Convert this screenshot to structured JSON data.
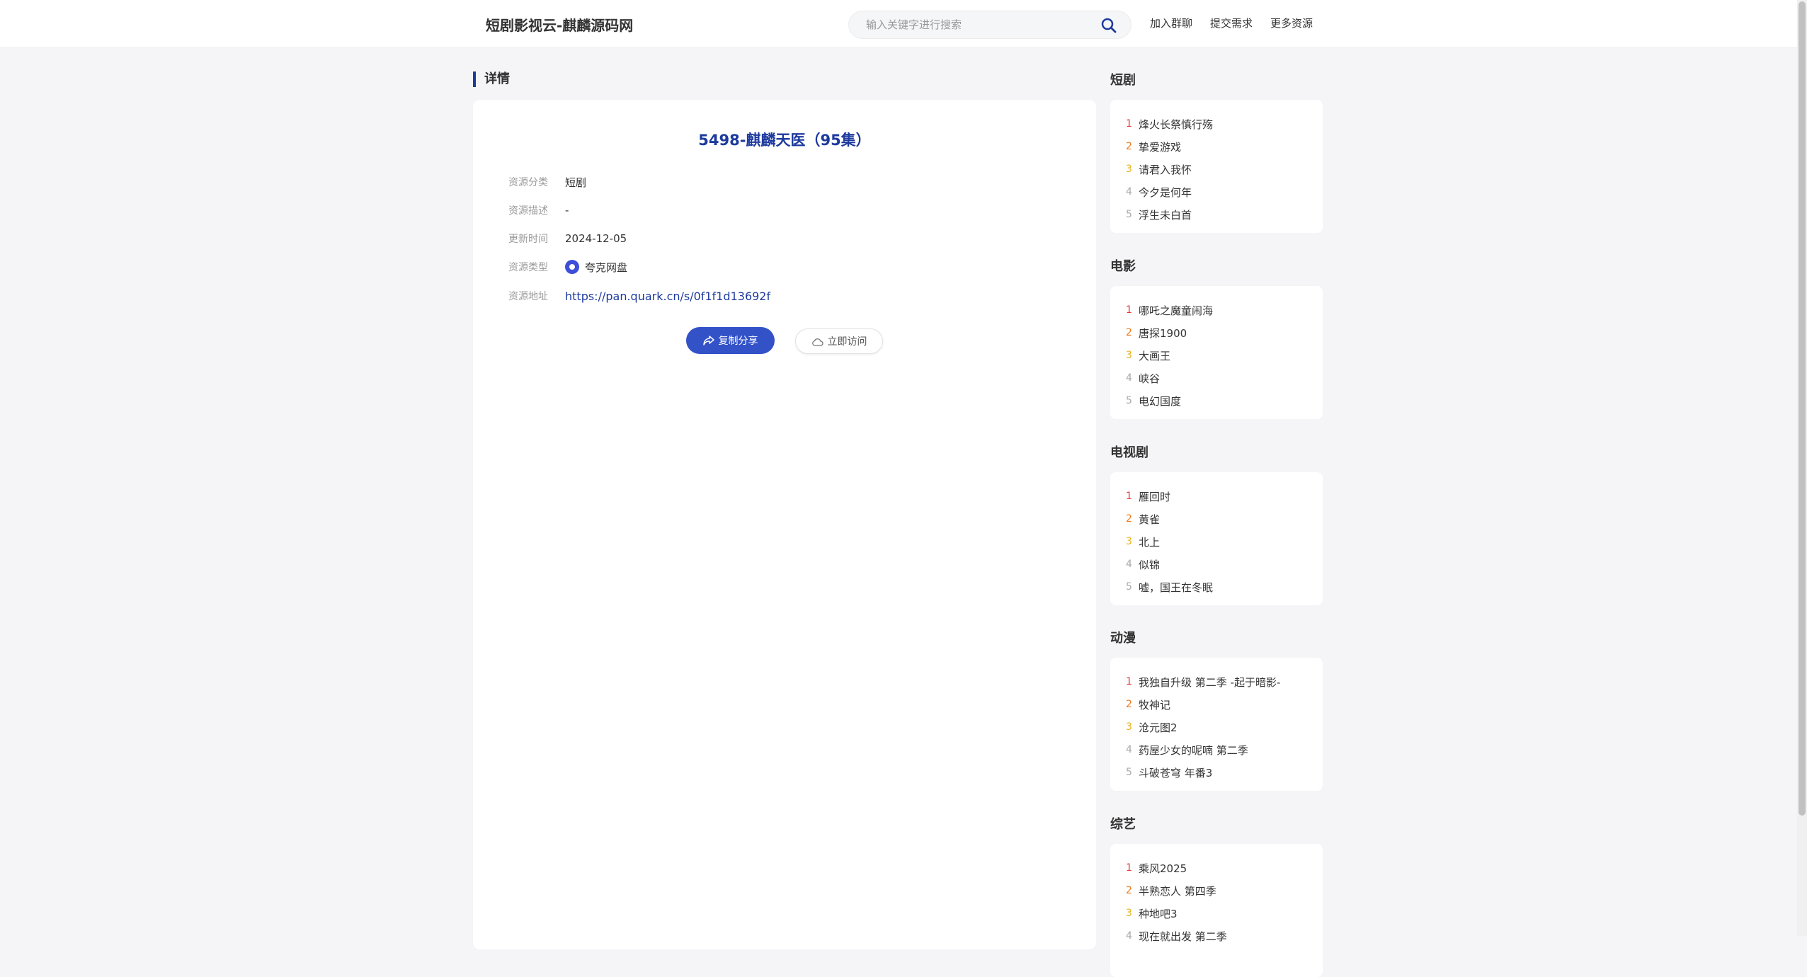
{
  "header": {
    "site_title": "短剧影视云-麒麟源码网",
    "search_placeholder": "输入关键字进行搜索",
    "nav": [
      "加入群聊",
      "提交需求",
      "更多资源"
    ]
  },
  "detail": {
    "section_title": "详情",
    "title": "5498-麒麟天医（95集）",
    "fields": {
      "category": {
        "label": "资源分类",
        "value": "短剧"
      },
      "description": {
        "label": "资源描述",
        "value": "-"
      },
      "updated": {
        "label": "更新时间",
        "value": "2024-12-05"
      },
      "type": {
        "label": "资源类型",
        "value": "夸克网盘"
      },
      "url": {
        "label": "资源地址",
        "value": "https://pan.quark.cn/s/0f1f1d13692f"
      }
    },
    "copy_button": "复制分享",
    "visit_button": "立即访问"
  },
  "sidebar": {
    "rank_colors": [
      "#e03a3a",
      "#f07a1d",
      "#e8b21c",
      "#aaaaaa",
      "#aaaaaa"
    ],
    "sections": [
      {
        "title": "短剧",
        "items": [
          "烽火长祭慎行殇",
          "挚爱游戏",
          "请君入我怀",
          "今夕是何年",
          "浮生未白首"
        ]
      },
      {
        "title": "电影",
        "items": [
          "哪吒之魔童闹海",
          "唐探1900",
          "大画王",
          "峡谷",
          "电幻国度"
        ]
      },
      {
        "title": "电视剧",
        "items": [
          "雁回时",
          "黄雀",
          "北上",
          "似锦",
          "嘘，国王在冬眠"
        ]
      },
      {
        "title": "动漫",
        "items": [
          "我独自升级 第二季 -起于暗影-",
          "牧神记",
          "沧元图2",
          "药屋少女的呢喃 第二季",
          "斗破苍穹 年番3"
        ]
      },
      {
        "title": "综艺",
        "items": [
          "乘风2025",
          "半熟恋人 第四季",
          "种地吧3",
          "现在就出发 第二季",
          ""
        ]
      }
    ]
  },
  "colors": {
    "accent": "#1d3a9d",
    "button": "#3352c8"
  }
}
